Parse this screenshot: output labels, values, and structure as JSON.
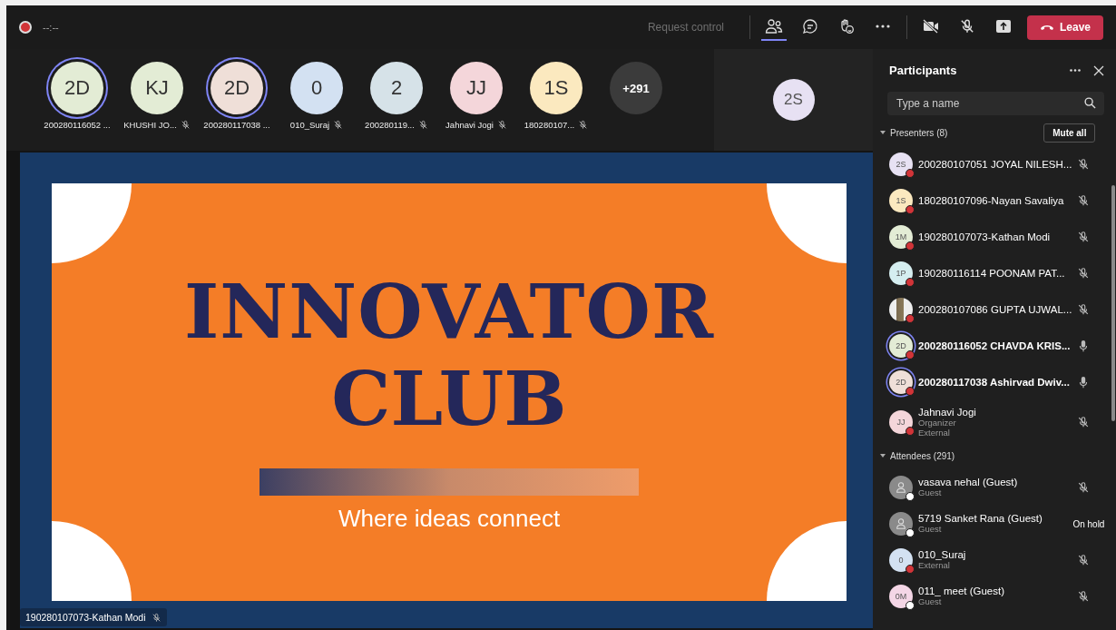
{
  "top_bar": {
    "recording": true,
    "timer": "--:--",
    "request_control": "Request control",
    "leave": "Leave"
  },
  "strip": [
    {
      "initials": "2D",
      "color": "#e3ecd5",
      "name": "200280116052 ...",
      "muted": false,
      "speaking": true
    },
    {
      "initials": "KJ",
      "color": "#e3ecd5",
      "name": "KHUSHI JO...",
      "muted": true,
      "speaking": false
    },
    {
      "initials": "2D",
      "color": "#efdfd8",
      "name": "200280117038 ...",
      "muted": false,
      "speaking": true
    },
    {
      "initials": "0",
      "color": "#d3e1f2",
      "name": "010_Suraj",
      "muted": true,
      "speaking": false
    },
    {
      "initials": "2",
      "color": "#d6e2e8",
      "name": "200280119...",
      "muted": true,
      "speaking": false
    },
    {
      "initials": "JJ",
      "color": "#f4d6da",
      "name": "Jahnavi Jogi",
      "muted": true,
      "speaking": false
    },
    {
      "initials": "1S",
      "color": "#fbe9bf",
      "name": "180280107...",
      "muted": true,
      "speaking": false
    }
  ],
  "overflow": "+291",
  "featured": {
    "initials": "2S",
    "color": "#e7e1f3"
  },
  "slide": {
    "title_1": "INNOVATOR",
    "title_2": "CLUB",
    "tagline": "Where ideas connect",
    "presenter": "190280107073-Kathan Modi",
    "presenter_muted": true
  },
  "panel": {
    "title": "Participants",
    "search": {
      "placeholder": "Type a name"
    },
    "mute_all": "Mute all",
    "groups": [
      {
        "label": "Presenters (8)",
        "expanded": true,
        "people": [
          {
            "kind": "initials",
            "initials": "2S",
            "color": "#e7e1f3",
            "name": "200280107051 JOYAL NILESH...",
            "muted": true,
            "in_call": true,
            "speaking": false
          },
          {
            "kind": "initials",
            "initials": "1S",
            "color": "#fbe9bf",
            "name": "180280107096-Nayan Savaliya",
            "muted": true,
            "in_call": true,
            "speaking": false
          },
          {
            "kind": "initials",
            "initials": "1M",
            "color": "#e3ecd5",
            "name": "190280107073-Kathan Modi",
            "muted": true,
            "in_call": true,
            "speaking": false
          },
          {
            "kind": "initials",
            "initials": "1P",
            "color": "#d5eef0",
            "name": "190280116114 POONAM PAT...",
            "muted": true,
            "in_call": true,
            "speaking": false
          },
          {
            "kind": "photo",
            "name": "200280107086 GUPTA UJWAL...",
            "muted": true,
            "in_call": true,
            "speaking": false
          },
          {
            "kind": "initials",
            "initials": "2D",
            "color": "#e3ecd5",
            "name": "200280116052 CHAVDA KRIS...",
            "muted": false,
            "in_call": true,
            "speaking": true
          },
          {
            "kind": "initials",
            "initials": "2D",
            "color": "#efdfd8",
            "name": "200280117038 Ashirvad Dwiv...",
            "muted": false,
            "in_call": true,
            "speaking": true
          },
          {
            "kind": "initials",
            "initials": "JJ",
            "color": "#f4d6da",
            "name": "Jahnavi Jogi",
            "details": [
              "Organizer",
              "External"
            ],
            "muted": true,
            "in_call": true,
            "speaking": false
          }
        ]
      },
      {
        "label": "Attendees (291)",
        "expanded": true,
        "people": [
          {
            "kind": "guest",
            "name": "vasava nehal (Guest)",
            "details": [
              "Guest"
            ],
            "muted": true,
            "in_call": false,
            "speaking": false
          },
          {
            "kind": "guest",
            "name": "5719 Sanket Rana (Guest)",
            "details": [
              "Guest"
            ],
            "hold": "On hold",
            "in_call": false,
            "speaking": false
          },
          {
            "kind": "initials",
            "initials": "0",
            "color": "#d3e1f2",
            "name": "010_Suraj",
            "details": [
              "External"
            ],
            "muted": true,
            "in_call": true,
            "speaking": false
          },
          {
            "kind": "initials",
            "initials": "0M",
            "color": "#f4d6e6",
            "name": "011_ meet (Guest)",
            "details": [
              "Guest"
            ],
            "muted": true,
            "in_call": false,
            "speaking": false
          }
        ]
      }
    ]
  }
}
